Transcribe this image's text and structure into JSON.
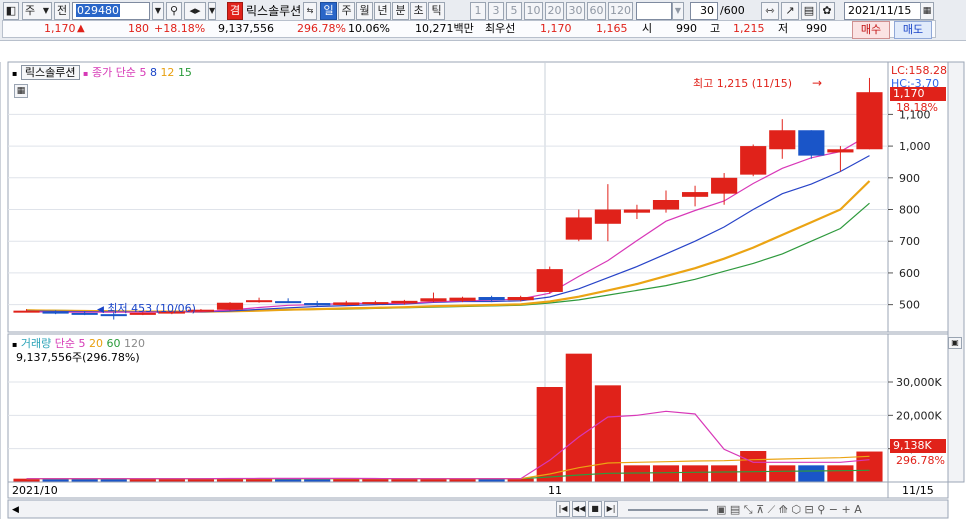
{
  "toolbar": {
    "market": "주",
    "prev_label": "전",
    "code": "029480",
    "name_badge": "겸",
    "stock_name": "릭스솔루션",
    "periods": [
      "일",
      "주",
      "월",
      "년",
      "분",
      "초",
      "틱"
    ],
    "active_period": "일",
    "minute_values": [
      "1",
      "3",
      "5",
      "10",
      "20",
      "30",
      "60",
      "120"
    ],
    "count": "30",
    "count_total": "/600",
    "date": "2021/11/15"
  },
  "infobar": {
    "price": "1,170",
    "change": "180",
    "change_pct": "+18.18%",
    "volume": "9,137,556",
    "volume_ratio": "296.78%",
    "turnover": "10.06%",
    "amount": "10,271백만",
    "best_label": "최우선",
    "ask": "1,170",
    "bid": "1,165",
    "open_label": "시",
    "open": "990",
    "high_label": "고",
    "high": "1,215",
    "low_label": "저",
    "low": "990",
    "buy_label": "매수",
    "sell_label": "매도"
  },
  "price_panel": {
    "legend_name": "릭스솔루션",
    "legend_ma": "종가 단순",
    "ma_periods": [
      "5",
      "8",
      "12",
      "15"
    ],
    "lc_label": "LC:158.28",
    "hc_label": "HC:-3.70",
    "current_price_tag": "1,170",
    "current_pct_tag": "18.18%",
    "high_annotation": "최고 1,215 (11/15)",
    "low_annotation": "최저 453 (10/06)",
    "y_ticks": [
      "1,100",
      "1,000",
      "900",
      "800",
      "700",
      "600",
      "500"
    ]
  },
  "volume_panel": {
    "legend_name": "거래량",
    "legend_ma": "단순",
    "ma_periods": [
      "5",
      "20",
      "60",
      "120"
    ],
    "value_label": "9,137,556주(296.78%)",
    "y_ticks": [
      "30,000K",
      "20,000K",
      "10,000K"
    ],
    "current_vol_tag": "9,138K",
    "current_vol_pct": "296.78%"
  },
  "x_axis": {
    "labels": [
      "2021/10",
      "11",
      "11/15"
    ]
  },
  "colors": {
    "up": "#e0221a",
    "down": "#1a55c8",
    "ma5": "#d838b8",
    "ma8": "#2844c8",
    "ma12": "#eba414",
    "ma15": "#2f9a3e"
  },
  "chart_data": {
    "type": "candlestick",
    "ohlc": [
      {
        "o": 481,
        "h": 486,
        "l": 477,
        "c": 481
      },
      {
        "o": 478,
        "h": 482,
        "l": 470,
        "c": 472
      },
      {
        "o": 474,
        "h": 478,
        "l": 467,
        "c": 469
      },
      {
        "o": 470,
        "h": 476,
        "l": 453,
        "c": 468
      },
      {
        "o": 470,
        "h": 476,
        "l": 467,
        "c": 474
      },
      {
        "o": 476,
        "h": 480,
        "l": 470,
        "c": 478
      },
      {
        "o": 480,
        "h": 486,
        "l": 478,
        "c": 484
      },
      {
        "o": 484,
        "h": 508,
        "l": 482,
        "c": 506
      },
      {
        "o": 512,
        "h": 522,
        "l": 506,
        "c": 514
      },
      {
        "o": 511,
        "h": 520,
        "l": 505,
        "c": 508
      },
      {
        "o": 505,
        "h": 512,
        "l": 495,
        "c": 498
      },
      {
        "o": 499,
        "h": 512,
        "l": 496,
        "c": 507
      },
      {
        "o": 504,
        "h": 512,
        "l": 500,
        "c": 508
      },
      {
        "o": 504,
        "h": 515,
        "l": 500,
        "c": 512
      },
      {
        "o": 510,
        "h": 538,
        "l": 508,
        "c": 520
      },
      {
        "o": 512,
        "h": 525,
        "l": 508,
        "c": 522
      },
      {
        "o": 524,
        "h": 528,
        "l": 508,
        "c": 514
      },
      {
        "o": 514,
        "h": 528,
        "l": 510,
        "c": 524
      },
      {
        "o": 540,
        "h": 620,
        "l": 535,
        "c": 612
      },
      {
        "o": 705,
        "h": 800,
        "l": 700,
        "c": 775
      },
      {
        "o": 755,
        "h": 880,
        "l": 700,
        "c": 800
      },
      {
        "o": 790,
        "h": 815,
        "l": 770,
        "c": 800
      },
      {
        "o": 800,
        "h": 860,
        "l": 790,
        "c": 830
      },
      {
        "o": 840,
        "h": 875,
        "l": 810,
        "c": 855
      },
      {
        "o": 850,
        "h": 915,
        "l": 815,
        "c": 900
      },
      {
        "o": 910,
        "h": 1005,
        "l": 905,
        "c": 1000
      },
      {
        "o": 990,
        "h": 1085,
        "l": 960,
        "c": 1050
      },
      {
        "o": 1050,
        "h": 1050,
        "l": 960,
        "c": 970
      },
      {
        "o": 980,
        "h": 1000,
        "l": 920,
        "c": 990
      },
      {
        "o": 990,
        "h": 1215,
        "l": 990,
        "c": 1170
      }
    ],
    "volume_k": [
      1000,
      1000,
      1000,
      1000,
      1000,
      1000,
      1000,
      1200,
      1200,
      1000,
      1000,
      1000,
      1000,
      1000,
      1000,
      1000,
      1000,
      1000,
      28500,
      38500,
      29000,
      5000,
      5000,
      5000,
      5000,
      9300,
      5000,
      5000,
      5000,
      9138
    ],
    "ma5": [
      478,
      476,
      476,
      476,
      476,
      476,
      478,
      483,
      491,
      498,
      500,
      504,
      504,
      504,
      509,
      512,
      514,
      518,
      536,
      589,
      639,
      702,
      763,
      797,
      827,
      882,
      930,
      963,
      983,
      1036
    ],
    "ma8": [
      480,
      479,
      478,
      477,
      477,
      477,
      477,
      480,
      485,
      490,
      494,
      497,
      500,
      502,
      507,
      510,
      510,
      512,
      524,
      550,
      585,
      620,
      660,
      700,
      745,
      800,
      850,
      880,
      920,
      970
    ],
    "ma12": [
      482,
      481,
      480,
      479,
      478,
      478,
      478,
      479,
      481,
      484,
      486,
      488,
      490,
      492,
      495,
      497,
      499,
      501,
      510,
      525,
      545,
      565,
      590,
      615,
      645,
      680,
      720,
      760,
      800,
      890
    ],
    "ma15": [
      483,
      482,
      481,
      480,
      479,
      479,
      479,
      480,
      481,
      483,
      485,
      486,
      488,
      490,
      492,
      494,
      496,
      498,
      505,
      515,
      530,
      545,
      560,
      580,
      605,
      630,
      660,
      700,
      740,
      820
    ],
    "vol_ma5": [
      1000,
      1000,
      1000,
      1000,
      1000,
      1000,
      1000,
      1050,
      1080,
      1080,
      1080,
      1080,
      1050,
      1000,
      1000,
      1000,
      1000,
      1000,
      6500,
      13500,
      19500,
      20000,
      21200,
      20400,
      9800,
      5900,
      5900,
      5900,
      5900,
      6700
    ],
    "vol_ma20": [
      1000,
      1000,
      1000,
      1000,
      1000,
      1000,
      1000,
      1010,
      1020,
      1020,
      1020,
      1020,
      1020,
      1020,
      1020,
      1020,
      1020,
      1020,
      2400,
      4300,
      5700,
      5900,
      6100,
      6300,
      6400,
      6700,
      6900,
      7100,
      7300,
      7700
    ],
    "vol_ma60": [
      1000,
      1000,
      1000,
      1000,
      1000,
      1000,
      1000,
      1000,
      1000,
      1000,
      1000,
      1000,
      1000,
      1000,
      1000,
      1000,
      1000,
      1000,
      1500,
      2100,
      2600,
      2700,
      2800,
      2900,
      3000,
      3100,
      3200,
      3300,
      3400,
      3500
    ],
    "price_ylim": [
      420,
      1240
    ],
    "volume_ylim": [
      0,
      42000
    ],
    "xlabels": [
      "2021/10",
      "11",
      "11/15"
    ]
  }
}
